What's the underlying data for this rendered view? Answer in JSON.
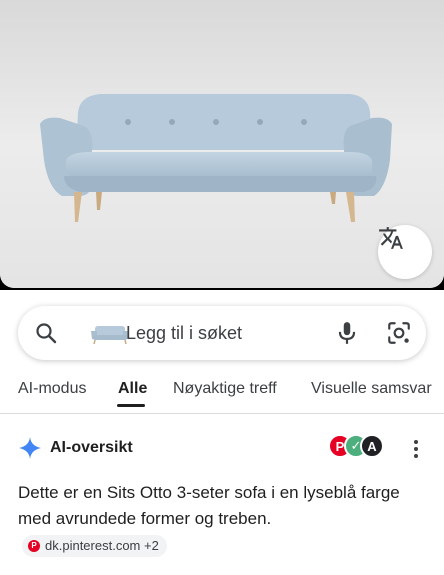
{
  "image": {
    "subject": "light blue three-seat sofa with wooden legs",
    "colors": {
      "background": "#e9e9e9",
      "sofa": "#b4c8d8",
      "legs": "#d2b48c"
    }
  },
  "translate_button": {
    "icon": "translate-icon"
  },
  "search": {
    "value": "Legg til i søket",
    "icons": {
      "left": "search-icon",
      "thumbnail": "sofa-thumbnail",
      "mic": "mic-icon",
      "lens": "lens-icon"
    }
  },
  "tabs": [
    {
      "label": "AI-modus",
      "active": false
    },
    {
      "label": "Alle",
      "active": true
    },
    {
      "label": "Nøyaktige treff",
      "active": false
    },
    {
      "label": "Visuelle samsvar",
      "active": false
    }
  ],
  "ai_overview": {
    "title": "AI-oversikt",
    "source_icons": [
      "pinterest-icon",
      "source-icon-2",
      "source-icon-3"
    ],
    "text": "Dette er en Sits Otto 3-seter sofa i en lyseblå farge med avrundede former og treben.",
    "citation_chip": "dk.pinterest.com +2",
    "accent_color": "#4285f4"
  }
}
